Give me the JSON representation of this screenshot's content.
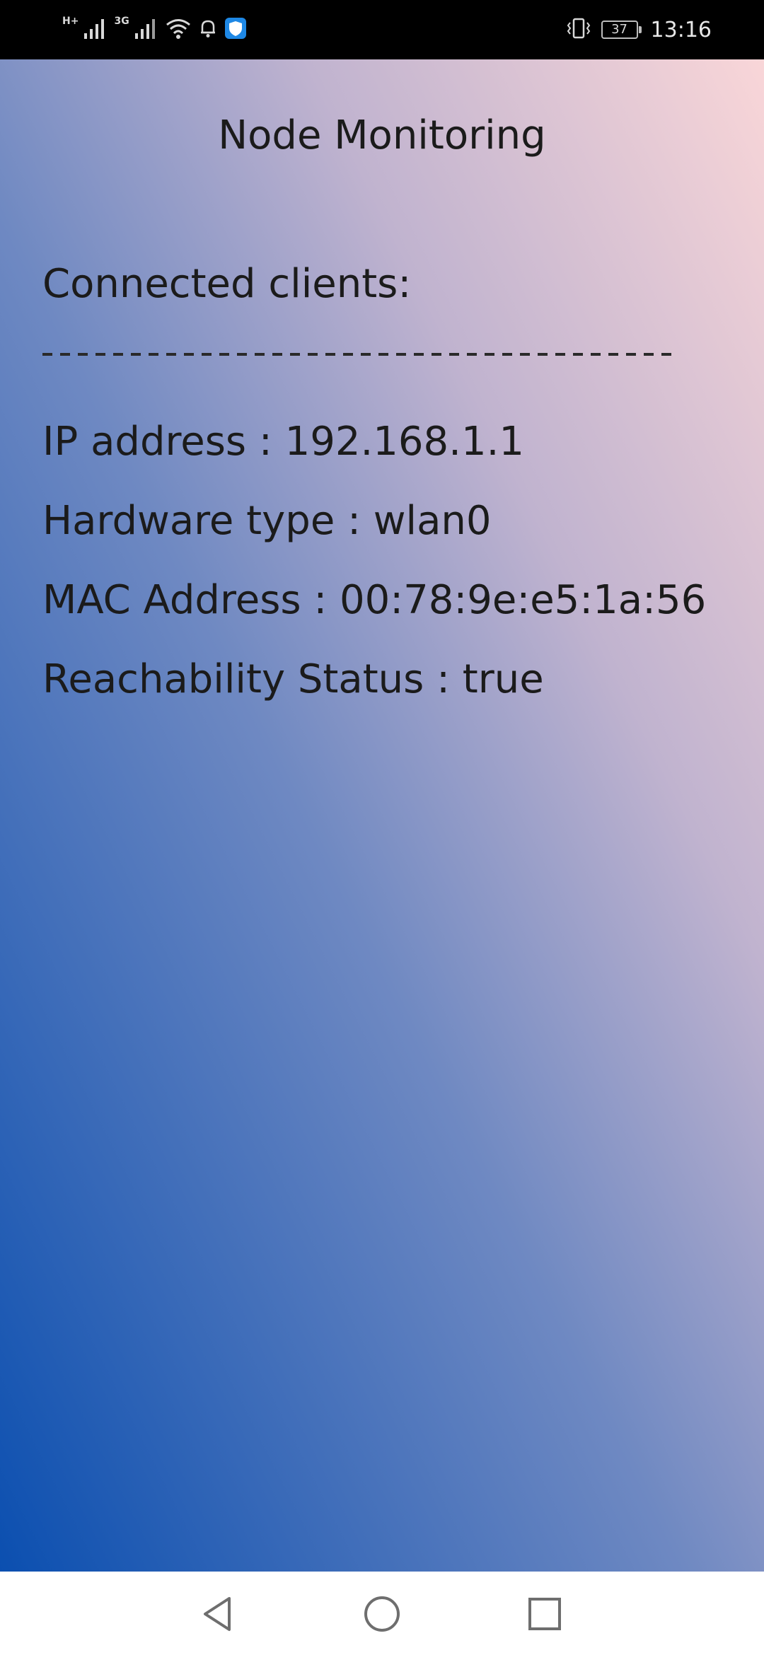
{
  "status_bar": {
    "network_tag_1": "H+",
    "network_tag_2": "3G",
    "battery_level": "37",
    "time": "13:16"
  },
  "app": {
    "title": "Node Monitoring"
  },
  "clients": {
    "heading": "Connected clients:",
    "divider": "------------------------------------",
    "ip_address": "IP address : 192.168.1.1",
    "hardware_type": "Hardware type : wlan0",
    "mac_address": "MAC Address : 00:78:9e:e5:1a:56",
    "reachability_status": "Reachability Status : true"
  },
  "navigation": {
    "icons": [
      "back-icon",
      "home-icon",
      "recents-icon"
    ]
  },
  "colors": {
    "status_bar_bg": "#000000",
    "gradient_bottom_left": "#0b4fb0",
    "gradient_top_right": "#f9d6d8",
    "nav_bar_bg": "#ffffff"
  }
}
